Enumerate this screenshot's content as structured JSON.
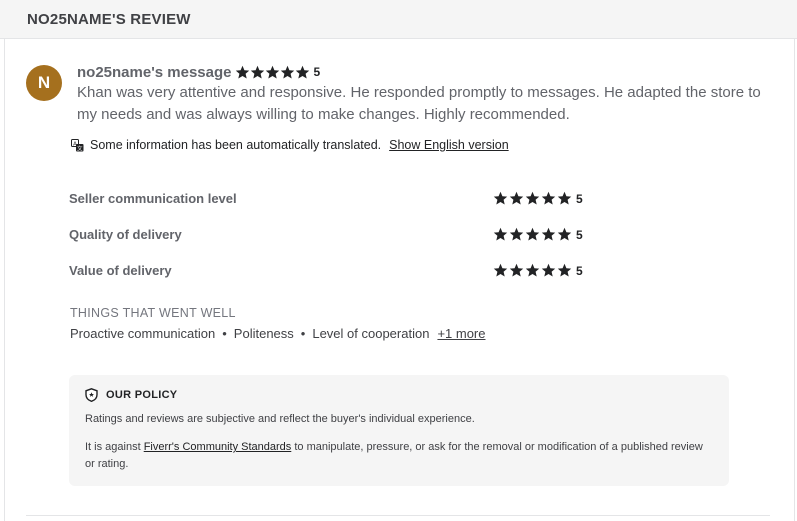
{
  "header": {
    "title": "NO25NAME'S REVIEW"
  },
  "review": {
    "avatar_letter": "N",
    "avatar_color": "#a5701e",
    "title": "no25name's message",
    "stars": 5,
    "score": "5",
    "body": "Khan was very attentive and responsive. He responded promptly to messages. He adapted the store to my needs and was always willing to make changes. Highly recommended."
  },
  "translation": {
    "icon": "translate-icon",
    "notice": "Some information has been automatically translated.",
    "link": "Show English version"
  },
  "ratings": [
    {
      "label": "Seller communication level",
      "stars": 5,
      "score": "5"
    },
    {
      "label": "Quality of delivery",
      "stars": 5,
      "score": "5"
    },
    {
      "label": "Value of delivery",
      "stars": 5,
      "score": "5"
    }
  ],
  "went_well": {
    "title": "THINGS THAT WENT WELL",
    "items": [
      "Proactive communication",
      "Politeness",
      "Level of cooperation"
    ],
    "more": "+1 more"
  },
  "policy": {
    "icon": "shield-star-icon",
    "title": "OUR POLICY",
    "text1": "Ratings and reviews are subjective and reflect the buyer's individual experience.",
    "text2_before": "It is against ",
    "text2_link": "Fiverr's Community Standards",
    "text2_after": " to manipulate, pressure, or ask for the removal or modification of a published review or rating."
  }
}
